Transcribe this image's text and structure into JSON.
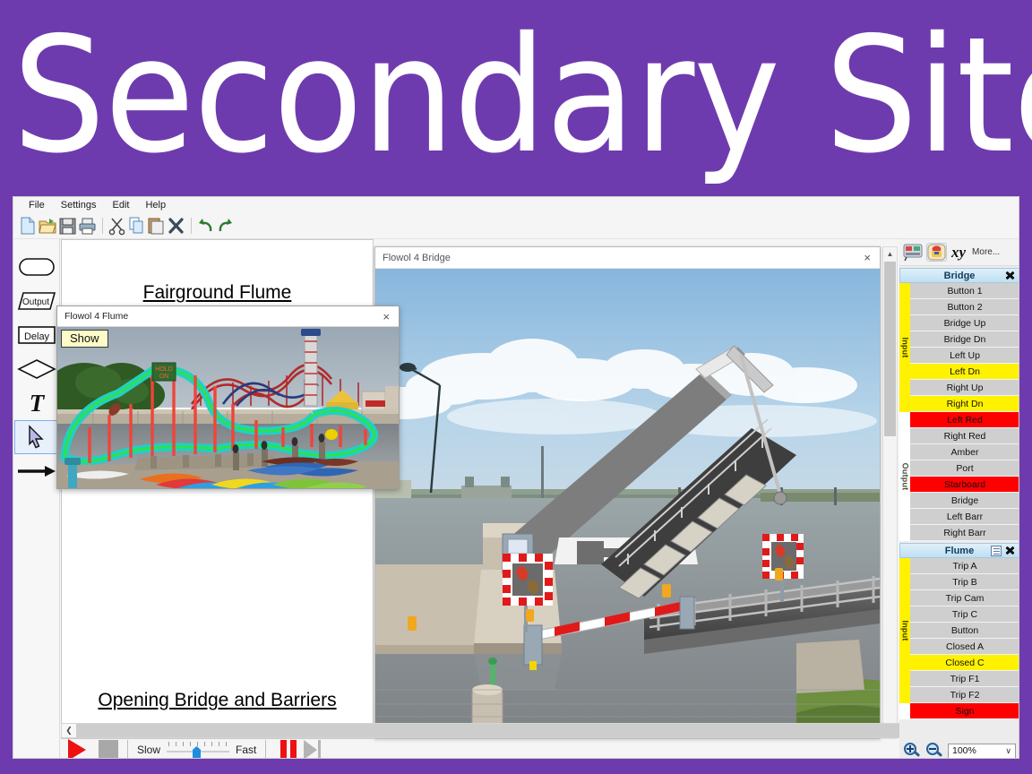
{
  "banner": {
    "title": "Secondary Site",
    "bg_color": "#6E3BAE"
  },
  "app": {
    "menubar": [
      "File",
      "Settings",
      "Edit",
      "Help"
    ],
    "toolbar_icons": [
      "new-file-icon",
      "open-folder-icon",
      "save-disk-icon",
      "print-icon",
      "cut-scissors-icon",
      "copy-icon",
      "paste-icon",
      "delete-x-icon",
      "undo-icon",
      "redo-icon"
    ]
  },
  "palette": {
    "items": [
      {
        "name": "terminal-shape-tool",
        "label": ""
      },
      {
        "name": "output-shape-tool",
        "label": "Output"
      },
      {
        "name": "delay-shape-tool",
        "label": "Delay"
      },
      {
        "name": "decision-shape-tool",
        "label": ""
      },
      {
        "name": "text-tool",
        "label": "T"
      },
      {
        "name": "pointer-tool",
        "label": ""
      },
      {
        "name": "connector-arrow-tool",
        "label": ""
      }
    ],
    "selected": "pointer-tool"
  },
  "flowchart": {
    "label_top": "Fairground Flume",
    "label_bottom": "Opening Bridge and Barriers"
  },
  "transport": {
    "play": "play-button",
    "stop": "stop-button",
    "slow_label": "Slow",
    "fast_label": "Fast",
    "speed_percent": 45,
    "pause": "pause-button",
    "step": "step-button"
  },
  "windows": {
    "bridge": {
      "title": "Flowol 4 Bridge",
      "close": "×"
    },
    "flume": {
      "title": "Flowol 4 Flume",
      "close": "×",
      "show_button": "Show"
    }
  },
  "io_toolbar": {
    "icons": [
      "mimic-board-icon",
      "variables-icon"
    ],
    "xy_label": "xy",
    "more_label": "More..."
  },
  "io_groups": [
    {
      "title": "Bridge",
      "has_report_icon": false,
      "close_icon": "close-x-icon",
      "sections": [
        {
          "band": "Input",
          "rows": [
            {
              "label": "Button 1",
              "state": "off"
            },
            {
              "label": "Button 2",
              "state": "off"
            },
            {
              "label": "Bridge Up",
              "state": "off"
            },
            {
              "label": "Bridge Dn",
              "state": "off"
            },
            {
              "label": "Left Up",
              "state": "off"
            },
            {
              "label": "Left Dn",
              "state": "on-yellow"
            },
            {
              "label": "Right Up",
              "state": "off"
            },
            {
              "label": "Right Dn",
              "state": "on-yellow"
            }
          ]
        },
        {
          "band": "Output",
          "rows": [
            {
              "label": "Left Red",
              "state": "on-red"
            },
            {
              "label": "Right Red",
              "state": "off"
            },
            {
              "label": "Amber",
              "state": "off"
            },
            {
              "label": "Port",
              "state": "off"
            },
            {
              "label": "Starboard",
              "state": "on-red"
            },
            {
              "label": "Bridge",
              "state": "off"
            },
            {
              "label": "Left Barr",
              "state": "off"
            },
            {
              "label": "Right Barr",
              "state": "off"
            }
          ]
        }
      ]
    },
    {
      "title": "Flume",
      "has_report_icon": true,
      "close_icon": "close-x-icon",
      "sections": [
        {
          "band": "Input",
          "rows": [
            {
              "label": "Trip A",
              "state": "off"
            },
            {
              "label": "Trip B",
              "state": "off"
            },
            {
              "label": "Trip Cam",
              "state": "off"
            },
            {
              "label": "Trip C",
              "state": "off"
            },
            {
              "label": "Button",
              "state": "off"
            },
            {
              "label": "Closed A",
              "state": "off"
            },
            {
              "label": "Closed C",
              "state": "on-yellow"
            },
            {
              "label": "Trip F1",
              "state": "off"
            },
            {
              "label": "Trip F2",
              "state": "off"
            }
          ]
        },
        {
          "band": "",
          "rows": [
            {
              "label": "Sign",
              "state": "on-red"
            }
          ]
        }
      ]
    }
  ],
  "zoom": {
    "zoom_in": "zoom-in-icon",
    "zoom_out": "zoom-out-icon",
    "level": "100%",
    "chevron": "∨"
  },
  "flume_scene": {
    "sign_text": "HOLD ON"
  }
}
